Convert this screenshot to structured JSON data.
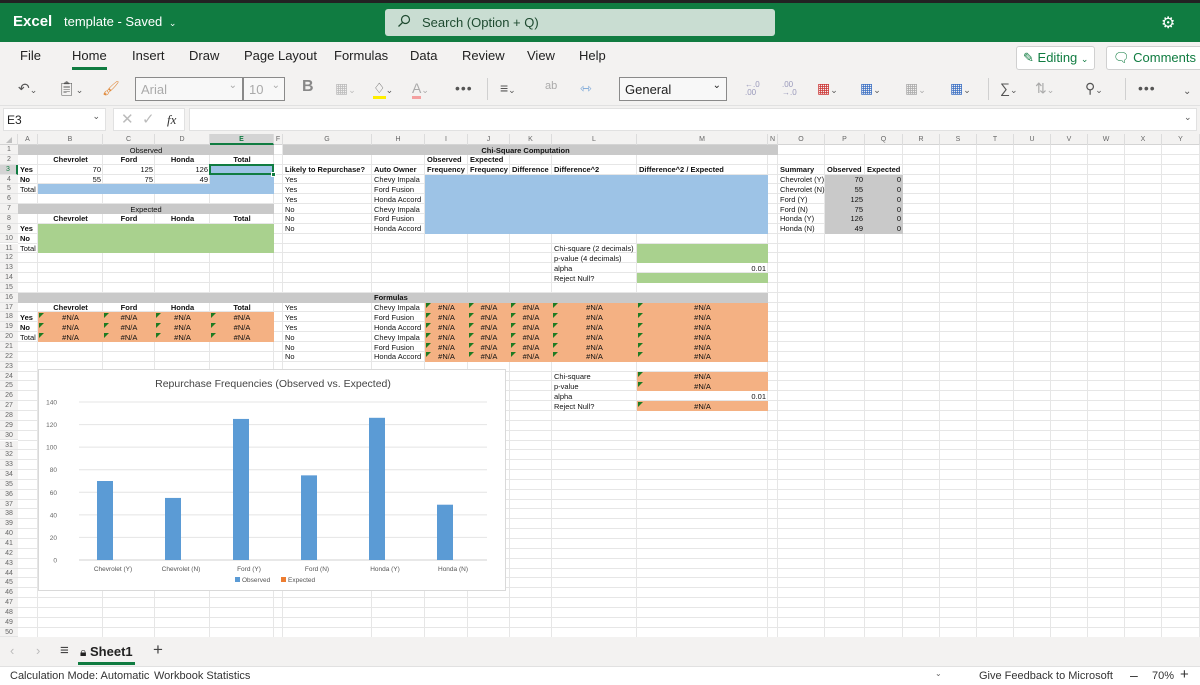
{
  "titlebar": {
    "app_name": "Excel",
    "doc_title": "template - Saved",
    "search_placeholder": "Search (Option + Q)",
    "settings_icon": "gear-icon"
  },
  "menu": {
    "items": [
      "File",
      "Home",
      "Insert",
      "Draw",
      "Page Layout",
      "Formulas",
      "Data",
      "Review",
      "View",
      "Help"
    ],
    "active": "Home",
    "editing_label": "Editing",
    "comments_label": "Comments"
  },
  "ribbon": {
    "font_name": "Arial",
    "font_size": "10",
    "number_format": "General",
    "bold_label": "B",
    "more_label": "•••",
    "decrease_decimal": "←.0\n.00",
    "increase_decimal": ".00\n→.0"
  },
  "formula_bar": {
    "name_box": "E3",
    "fx_label": "fx",
    "formula": ""
  },
  "grid": {
    "columns": [
      "A",
      "B",
      "C",
      "D",
      "E",
      "F",
      "G",
      "H",
      "I",
      "J",
      "K",
      "L",
      "M",
      "N",
      "O",
      "P",
      "Q",
      "R",
      "S",
      "T",
      "U",
      "V",
      "W",
      "X",
      "Y"
    ],
    "selected_column": "E",
    "selected_row": 3,
    "row_count": 50
  },
  "observed_table": {
    "title": "Observed",
    "headers": [
      "Chevrolet",
      "Ford",
      "Honda",
      "Total"
    ],
    "rows": [
      {
        "label": "Yes",
        "values": [
          "70",
          "125",
          "126",
          ""
        ]
      },
      {
        "label": "No",
        "values": [
          "55",
          "75",
          "49",
          ""
        ]
      },
      {
        "label": "Total",
        "values": [
          "",
          "",
          "",
          ""
        ]
      }
    ]
  },
  "expected_table": {
    "title": "Expected",
    "headers": [
      "Chevrolet",
      "Ford",
      "Honda",
      "Total"
    ],
    "rows": [
      {
        "label": "Yes"
      },
      {
        "label": "No"
      },
      {
        "label": "Total"
      }
    ]
  },
  "formula_table": {
    "headers": [
      "Chevrolet",
      "Ford",
      "Honda",
      "Total"
    ],
    "rows": [
      {
        "label": "Yes",
        "values": [
          "#N/A",
          "#N/A",
          "#N/A",
          "#N/A"
        ]
      },
      {
        "label": "No",
        "values": [
          "#N/A",
          "#N/A",
          "#N/A",
          "#N/A"
        ]
      },
      {
        "label": "Total",
        "values": [
          "#N/A",
          "#N/A",
          "#N/A",
          "#N/A"
        ]
      }
    ]
  },
  "chi_square": {
    "title": "Chi-Square Computation",
    "headers": {
      "repurchase": "Likely to Repurchase?",
      "owner": "Auto Owner",
      "observed_1": "Observed",
      "observed_2": "Frequency",
      "expected_1": "Expected",
      "expected_2": "Frequency",
      "difference": "Difference",
      "difference_sq": "Difference^2",
      "diff_sq_over_exp": "Difference^2 / Expected"
    },
    "rows": [
      {
        "repurchase": "Yes",
        "owner": "Chevy Impala"
      },
      {
        "repurchase": "Yes",
        "owner": "Ford Fusion"
      },
      {
        "repurchase": "Yes",
        "owner": "Honda Accord"
      },
      {
        "repurchase": "No",
        "owner": "Chevy Impala"
      },
      {
        "repurchase": "No",
        "owner": "Ford Fusion"
      },
      {
        "repurchase": "No",
        "owner": "Honda Accord"
      }
    ],
    "results": {
      "chi_label": "Chi-square (2 decimals)",
      "p_label": "p-value (4 decimals)",
      "alpha_label": "alpha",
      "alpha_value": "0.01",
      "reject_label": "Reject Null?"
    }
  },
  "formulas_section": {
    "title": "Formulas",
    "rows": [
      {
        "repurchase": "Yes",
        "owner": "Chevy Impala",
        "values": [
          "#N/A",
          "#N/A",
          "#N/A",
          "#N/A",
          "#N/A"
        ]
      },
      {
        "repurchase": "Yes",
        "owner": "Ford Fusion",
        "values": [
          "#N/A",
          "#N/A",
          "#N/A",
          "#N/A",
          "#N/A"
        ]
      },
      {
        "repurchase": "Yes",
        "owner": "Honda Accord",
        "values": [
          "#N/A",
          "#N/A",
          "#N/A",
          "#N/A",
          "#N/A"
        ]
      },
      {
        "repurchase": "No",
        "owner": "Chevy Impala",
        "values": [
          "#N/A",
          "#N/A",
          "#N/A",
          "#N/A",
          "#N/A"
        ]
      },
      {
        "repurchase": "No",
        "owner": "Ford Fusion",
        "values": [
          "#N/A",
          "#N/A",
          "#N/A",
          "#N/A",
          "#N/A"
        ]
      },
      {
        "repurchase": "No",
        "owner": "Honda Accord",
        "values": [
          "#N/A",
          "#N/A",
          "#N/A",
          "#N/A",
          "#N/A"
        ]
      }
    ],
    "results": {
      "chi_label": "Chi-square",
      "chi_value": "#N/A",
      "p_label": "p-value",
      "p_value": "#N/A",
      "alpha_label": "alpha",
      "alpha_value": "0.01",
      "reject_label": "Reject Null?",
      "reject_value": "#N/A"
    }
  },
  "summary": {
    "headers": [
      "Summary",
      "Observed",
      "Expected"
    ],
    "rows": [
      {
        "label": "Chevrolet (Y)",
        "observed": "70",
        "expected": "0"
      },
      {
        "label": "Chevrolet (N)",
        "observed": "55",
        "expected": "0"
      },
      {
        "label": "Ford (Y)",
        "observed": "125",
        "expected": "0"
      },
      {
        "label": "Ford (N)",
        "observed": "75",
        "expected": "0"
      },
      {
        "label": "Honda (Y)",
        "observed": "126",
        "expected": "0"
      },
      {
        "label": "Honda (N)",
        "observed": "49",
        "expected": "0"
      }
    ]
  },
  "chart_data": {
    "type": "bar",
    "title": "Repurchase Frequencies (Observed vs. Expected)",
    "categories": [
      "Chevrolet (Y)",
      "Chevrolet (N)",
      "Ford (Y)",
      "Ford (N)",
      "Honda (Y)",
      "Honda (N)"
    ],
    "series": [
      {
        "name": "Observed",
        "values": [
          70,
          55,
          125,
          75,
          126,
          49
        ],
        "color": "#5b9bd5"
      },
      {
        "name": "Expected",
        "values": [
          0,
          0,
          0,
          0,
          0,
          0
        ],
        "color": "#ed7d31"
      }
    ],
    "yticks": [
      0,
      20,
      40,
      60,
      80,
      100,
      120,
      140
    ],
    "ylim": [
      0,
      140
    ],
    "xlabel": "",
    "ylabel": "",
    "grid": true,
    "legend": "bottom"
  },
  "sheet_tabs": {
    "tabs": [
      "Sheet1"
    ],
    "active": "Sheet1"
  },
  "status": {
    "calc_mode": "Calculation Mode: Automatic",
    "workbook_stats": "Workbook Statistics",
    "feedback": "Give Feedback to Microsoft",
    "zoom": "70%"
  },
  "colors": {
    "brand_green": "#107c41",
    "blue_fill": "#9dc3e6",
    "green_fill": "#a9d18e",
    "orange_fill": "#f4b183",
    "gray_header": "#c9c9c9"
  }
}
